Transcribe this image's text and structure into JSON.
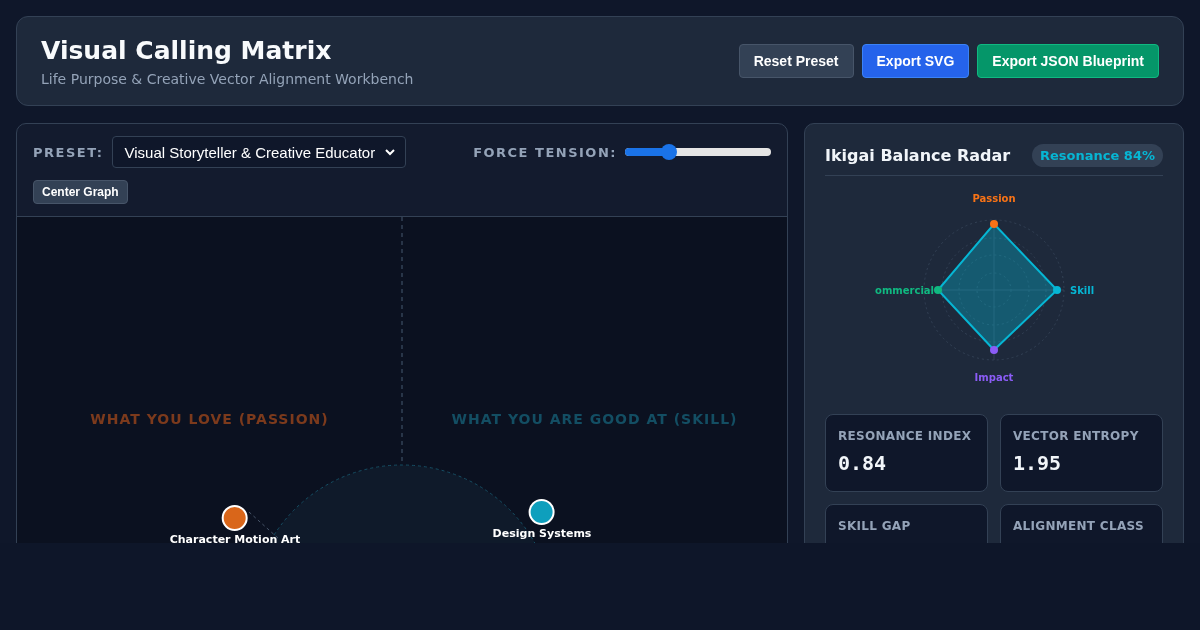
{
  "header": {
    "title": "Visual Calling Matrix",
    "subtitle": "Life Purpose & Creative Vector Alignment Workbench",
    "buttons": [
      {
        "label": "Reset Preset",
        "kind": "neutral"
      },
      {
        "label": "Export SVG",
        "kind": "primary"
      },
      {
        "label": "Export JSON Blueprint",
        "kind": "success"
      }
    ]
  },
  "controls": {
    "preset_label": "PRESET:",
    "preset_value": "Visual Storyteller & Creative Educator",
    "tension_label": "FORCE TENSION:",
    "tension": {
      "level": 0.3
    },
    "center_button": "Center Graph"
  },
  "graph": {
    "quadrants": [
      {
        "label": "WHAT YOU LOVE (PASSION)",
        "color": "#7c3a1c"
      },
      {
        "label": "WHAT YOU ARE GOOD AT (SKILL)",
        "color": "#134e63"
      }
    ],
    "nodes": [
      {
        "label": "Character Motion Art",
        "color": "#d9661a"
      },
      {
        "label": "Design Systems",
        "color": "#0e9fbd"
      }
    ]
  },
  "radar": {
    "title": "Ikigai Balance Radar",
    "badge": "Resonance 84%",
    "axes": [
      {
        "label": "Passion",
        "color": "#f97316"
      },
      {
        "label": "Skill",
        "color": "#06b6d4"
      },
      {
        "label": "Impact",
        "color": "#8b5cf6"
      },
      {
        "label": "ommercial",
        "color": "#10b981"
      }
    ]
  },
  "metrics": [
    {
      "label": "RESONANCE INDEX",
      "value": "0.84"
    },
    {
      "label": "VECTOR ENTROPY",
      "value": "1.95"
    },
    {
      "label": "SKILL GAP"
    },
    {
      "label": "ALIGNMENT CLASS"
    }
  ]
}
